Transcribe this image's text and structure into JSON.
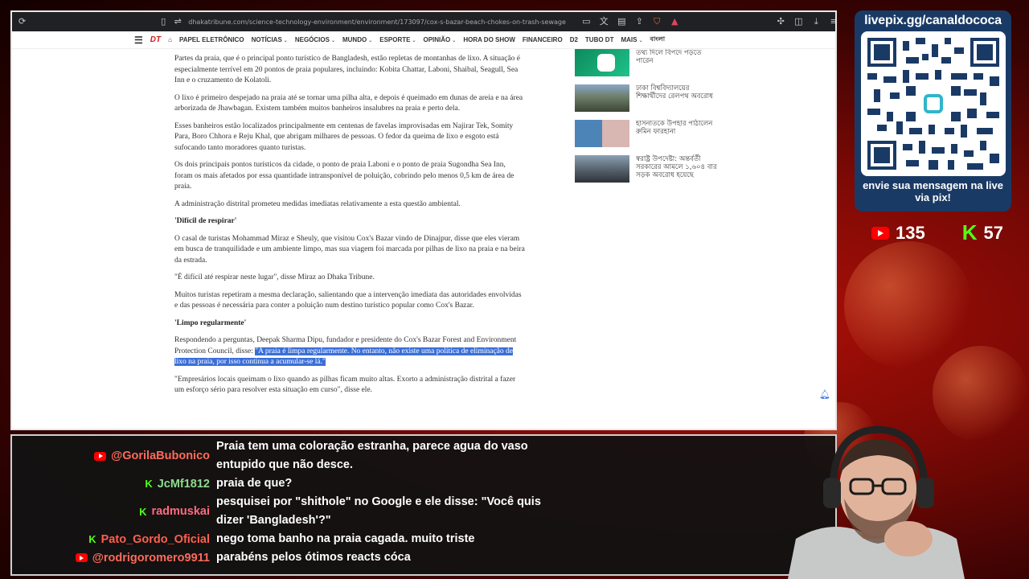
{
  "browser": {
    "url": "dhakatribune.com/science-technology-environment/environment/173097/cox-s-bazar-beach-chokes-on-trash-sewage"
  },
  "site_nav": {
    "logo": "DT",
    "items": [
      "PAPEL ELETRÔNICO",
      "NOTÍCIAS",
      "NEGÓCIOS",
      "MUNDO",
      "ESPORTE",
      "OPINIÃO",
      "HORA DO SHOW",
      "FINANCEIRO",
      "D2",
      "TUBO DT",
      "MAIS",
      "বাংলা"
    ]
  },
  "article": {
    "p1": "Partes da praia, que é o principal ponto turístico de Bangladesh, estão repletas de montanhas de lixo. A situação é especialmente terrível em 20 pontos de praia populares, incluindo: Kobita Chattar, Laboni, Shaibal, Seagull, Sea Inn e o cruzamento de Kolatoli.",
    "p2": "O lixo é primeiro despejado na praia até se tornar uma pilha alta, e depois é queimado em dunas de areia e na área arborizada de Jhawbagan. Existem também muitos banheiros insalubres na praia e perto dela.",
    "p3": "Esses banheiros estão localizados principalmente em centenas de favelas improvisadas em Najirar Tek, Somity Para, Boro Chhora e Reju Khal, que abrigam milhares de pessoas. O fedor da queima de lixo e esgoto está sufocando tanto moradores quanto turistas.",
    "p4": "Os dois principais pontos turísticos da cidade, o ponto de praia Laboni e o ponto de praia Sugondha Sea Inn, foram os mais afetados por essa quantidade intransponível de poluição, cobrindo pelo menos 0,5 km de área de praia.",
    "p5": "A administração distrital prometeu medidas imediatas relativamente a esta questão ambiental.",
    "h1": "'Difícil de respirar'",
    "p6": "O casal de turistas Mohammad Miraz e Sheuly, que visitou Cox's Bazar vindo de Dinajpur, disse que eles vieram em busca de tranquilidade e um ambiente limpo, mas sua viagem foi marcada por pilhas de lixo na praia e na beira da estrada.",
    "p7": "\"É difícil até respirar neste lugar\", disse Miraz ao Dhaka Tribune.",
    "p8": "Muitos turistas repetiram a mesma declaração, salientando que a intervenção imediata das autoridades envolvidas e das pessoas é necessária para conter a poluição num destino turístico popular como Cox's Bazar.",
    "h2": "'Limpo regularmente'",
    "p9_plain": "Respondendo a perguntas, Deepak Sharma Dipu, fundador e presidente do Cox's Bazar Forest and Environment Protection Council, disse: ",
    "p9_highlight": "\"A praia é limpa regularmente. No entanto, não existe uma política de eliminação de lixo na praia, por isso continua a acumular-se lá.\"",
    "p10": "\"Empresários locais queimam o lixo quando as pilhas ficam muito altas. Exorto a administração distrital a fazer um esforço sério para resolver esta situação em curso\", disse ele."
  },
  "sidebar": {
    "items": [
      {
        "text": "তথ্য দিলে বিপদে পড়তে পারেন"
      },
      {
        "text": "ঢাকা বিশ্ববিদ্যালয়ের শিক্ষার্থীদের রেলপথ অবরোধ"
      },
      {
        "text": "হাসনাতকে উপহার পাঠালেন রুমিন ফারহানা"
      },
      {
        "text": "স্বরাষ্ট্র উপদেষ্টা: অন্তর্বর্তী সরকারের আমলে ১,৬০৪ বার সড়ক অবরোধ হয়েছে"
      }
    ]
  },
  "pix": {
    "title": "livepix.gg/canaldococa",
    "footer": "envie sua mensagem na live via pix!"
  },
  "stats": {
    "youtube_viewers": "135",
    "kick_viewers": "57"
  },
  "chat": {
    "messages": [
      {
        "platform": "youtube",
        "user": "@GorilaBubonico",
        "text": "Praia tem uma coloração estranha, parece agua do vaso entupido que não desce."
      },
      {
        "platform": "kick",
        "user": "JcMf1812",
        "text": "praia de que?"
      },
      {
        "platform": "kick",
        "user": "radmuskai",
        "text": "pesquisei por \"shithole\" no Google e ele disse: \"Você quis dizer 'Bangladesh'?\""
      },
      {
        "platform": "kick",
        "user": "Pato_Gordo_Oficial",
        "text": "nego toma banho na praia cagada. muito triste"
      },
      {
        "platform": "youtube",
        "user": "@rodrigoromero9911",
        "text": "parabéns pelos ótimos reacts cóca"
      }
    ]
  },
  "colors": {
    "highlight": "#3b6fd8",
    "kick": "#53fc18",
    "youtube": "#ff0000",
    "brand_red": "#d81a1a"
  },
  "icons": [
    "refresh-icon",
    "bookmark-icon",
    "site-info-icon",
    "cast-icon",
    "translate-icon",
    "reader-icon",
    "share-icon",
    "brave-shield-icon",
    "brave-rewards-icon",
    "extensions-icon",
    "sidebar-icon",
    "download-icon",
    "menu-icon",
    "hamburger-icon",
    "home-icon",
    "bell-icon",
    "youtube-icon",
    "kick-icon"
  ]
}
